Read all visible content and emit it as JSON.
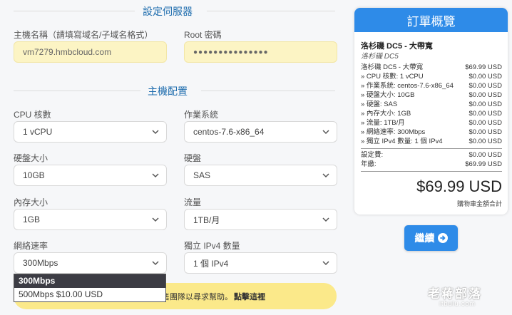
{
  "server_section": {
    "title": "設定伺服器",
    "hostname_label": "主機名稱（請填寫域名/子域名格式）",
    "hostname_value": "vm7279.hmbcloud.com",
    "root_label": "Root 密碼",
    "root_value": "●●●●●●●●●●●●●●●"
  },
  "config_section": {
    "title": "主機配置",
    "fields": [
      {
        "label": "CPU 核數",
        "value": "1 vCPU"
      },
      {
        "label": "作業系統",
        "value": "centos-7.6-x86_64"
      },
      {
        "label": "硬盤大小",
        "value": "10GB"
      },
      {
        "label": "硬盤",
        "value": "SAS"
      },
      {
        "label": "內存大小",
        "value": "1GB"
      },
      {
        "label": "流量",
        "value": "1TB/月"
      },
      {
        "label": "網絡速率",
        "value": "300Mbps"
      },
      {
        "label": "獨立 IPv4 數量",
        "value": "1 個 IPv4"
      }
    ],
    "dropdown_options": [
      "300Mbps",
      "500Mbps $10.00 USD"
    ]
  },
  "notice": {
    "text": "銷售團隊以尋求幫助。",
    "link": "點擊這裡"
  },
  "summary": {
    "title": "訂單概覽",
    "product_title": "洛杉磯 DC5 - 大帶寬",
    "product_sub": "洛杉磯 DC5",
    "lines": [
      {
        "label": "洛杉磯 DC5 - 大帶寬",
        "price": "$69.99 USD"
      },
      {
        "label": "» CPU 核數: 1 vCPU",
        "price": "$0.00 USD"
      },
      {
        "label": "» 作業系統: centos-7.6-x86_64",
        "price": "$0.00 USD"
      },
      {
        "label": "» 硬盤大小: 10GB",
        "price": "$0.00 USD"
      },
      {
        "label": "» 硬盤: SAS",
        "price": "$0.00 USD"
      },
      {
        "label": "» 內存大小: 1GB",
        "price": "$0.00 USD"
      },
      {
        "label": "» 流量: 1TB/月",
        "price": "$0.00 USD"
      },
      {
        "label": "» 網絡速率: 300Mbps",
        "price": "$0.00 USD"
      },
      {
        "label": "» 獨立 IPv4 數量: 1 個 IPv4",
        "price": "$0.00 USD"
      }
    ],
    "setup_label": "設定費:",
    "setup_price": "$0.00 USD",
    "annual_label": "年繳:",
    "annual_price": "$69.99 USD",
    "total": "$69.99 USD",
    "total_caption": "購物車金額合計"
  },
  "checkout": {
    "label": "繼續"
  },
  "watermark": {
    "text": "老蒋部落",
    "sub": "itbulu.com"
  },
  "colors": {
    "accent": "#2e8be8",
    "section_title": "#1f6dae",
    "input_yellow": "#fcf4c4",
    "notice_yellow": "#fbe98a"
  }
}
